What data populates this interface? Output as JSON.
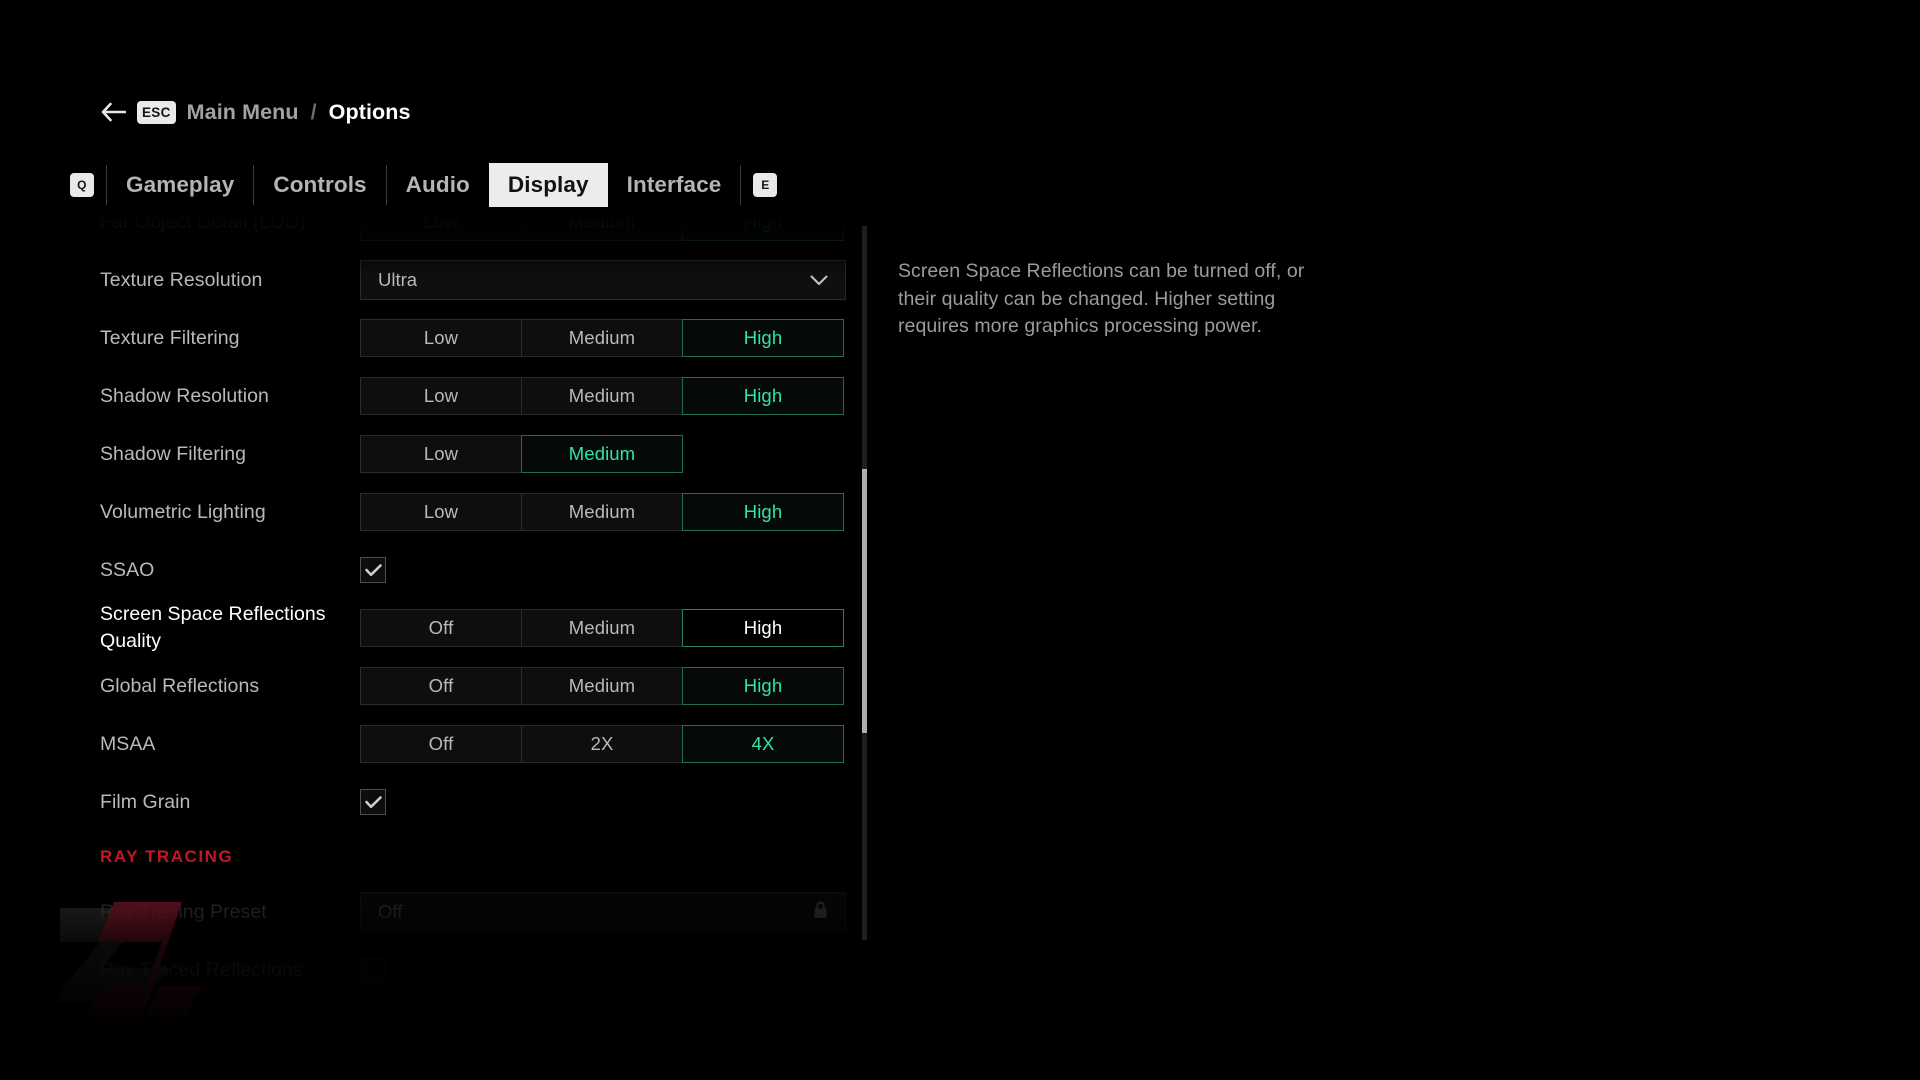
{
  "breadcrumb": {
    "back_icon": "left-arrow-icon",
    "esc_key": "ESC",
    "parent": "Main Menu",
    "separator": "/",
    "current": "Options"
  },
  "tabs": {
    "prev_key": "Q",
    "next_key": "E",
    "items": [
      {
        "label": "Gameplay",
        "active": false
      },
      {
        "label": "Controls",
        "active": false
      },
      {
        "label": "Audio",
        "active": false
      },
      {
        "label": "Display",
        "active": true
      },
      {
        "label": "Interface",
        "active": false
      }
    ]
  },
  "settings": [
    {
      "type": "segmented",
      "label": "Far Object Detail (LOD)",
      "options": [
        "Low",
        "Medium",
        "High"
      ],
      "selected": "High",
      "state": "clipped"
    },
    {
      "type": "dropdown",
      "label": "Texture Resolution",
      "value": "Ultra",
      "state": "normal"
    },
    {
      "type": "segmented",
      "label": "Texture Filtering",
      "options": [
        "Low",
        "Medium",
        "High"
      ],
      "selected": "High",
      "state": "normal"
    },
    {
      "type": "segmented",
      "label": "Shadow Resolution",
      "options": [
        "Low",
        "Medium",
        "High"
      ],
      "selected": "High",
      "state": "normal"
    },
    {
      "type": "segmented",
      "label": "Shadow Filtering",
      "options": [
        "Low",
        "Medium"
      ],
      "selected": "Medium",
      "state": "normal"
    },
    {
      "type": "segmented",
      "label": "Volumetric Lighting",
      "options": [
        "Low",
        "Medium",
        "High"
      ],
      "selected": "High",
      "state": "normal"
    },
    {
      "type": "checkbox",
      "label": "SSAO",
      "checked": true,
      "state": "normal"
    },
    {
      "type": "segmented",
      "label": "Screen Space Reflections Quality",
      "options": [
        "Off",
        "Medium",
        "High"
      ],
      "selected": "High",
      "state": "focused"
    },
    {
      "type": "segmented",
      "label": "Global Reflections",
      "options": [
        "Off",
        "Medium",
        "High"
      ],
      "selected": "High",
      "state": "normal"
    },
    {
      "type": "segmented",
      "label": "MSAA",
      "options": [
        "Off",
        "2X",
        "4X"
      ],
      "selected": "4X",
      "state": "normal"
    },
    {
      "type": "checkbox",
      "label": "Film Grain",
      "checked": true,
      "state": "normal"
    },
    {
      "type": "section",
      "label": "RAY TRACING"
    },
    {
      "type": "dropdown",
      "label": "Ray Tracing Preset",
      "value": "Off",
      "state": "disabled",
      "locked": true
    },
    {
      "type": "checkbox",
      "label": "Ray Traced Reflections",
      "checked": false,
      "state": "disabled"
    }
  ],
  "description": {
    "text": "Screen Space Reflections can be turned off, or their quality can be changed. Higher setting requires more graphics processing power."
  },
  "scrollbar": {
    "thumb_top_pct": 34,
    "thumb_height_pct": 37
  },
  "colors": {
    "accent_teal": "#2fe3ab",
    "section_red": "#ee1b2e",
    "tab_active_bg": "#ececec",
    "text_primary": "#ffffff",
    "text_muted": "#b9b9b9",
    "background": "#000000"
  },
  "watermark": {
    "name": "z-logo-watermark",
    "gray": "#6b6b6b",
    "crimson": "#c22440"
  }
}
